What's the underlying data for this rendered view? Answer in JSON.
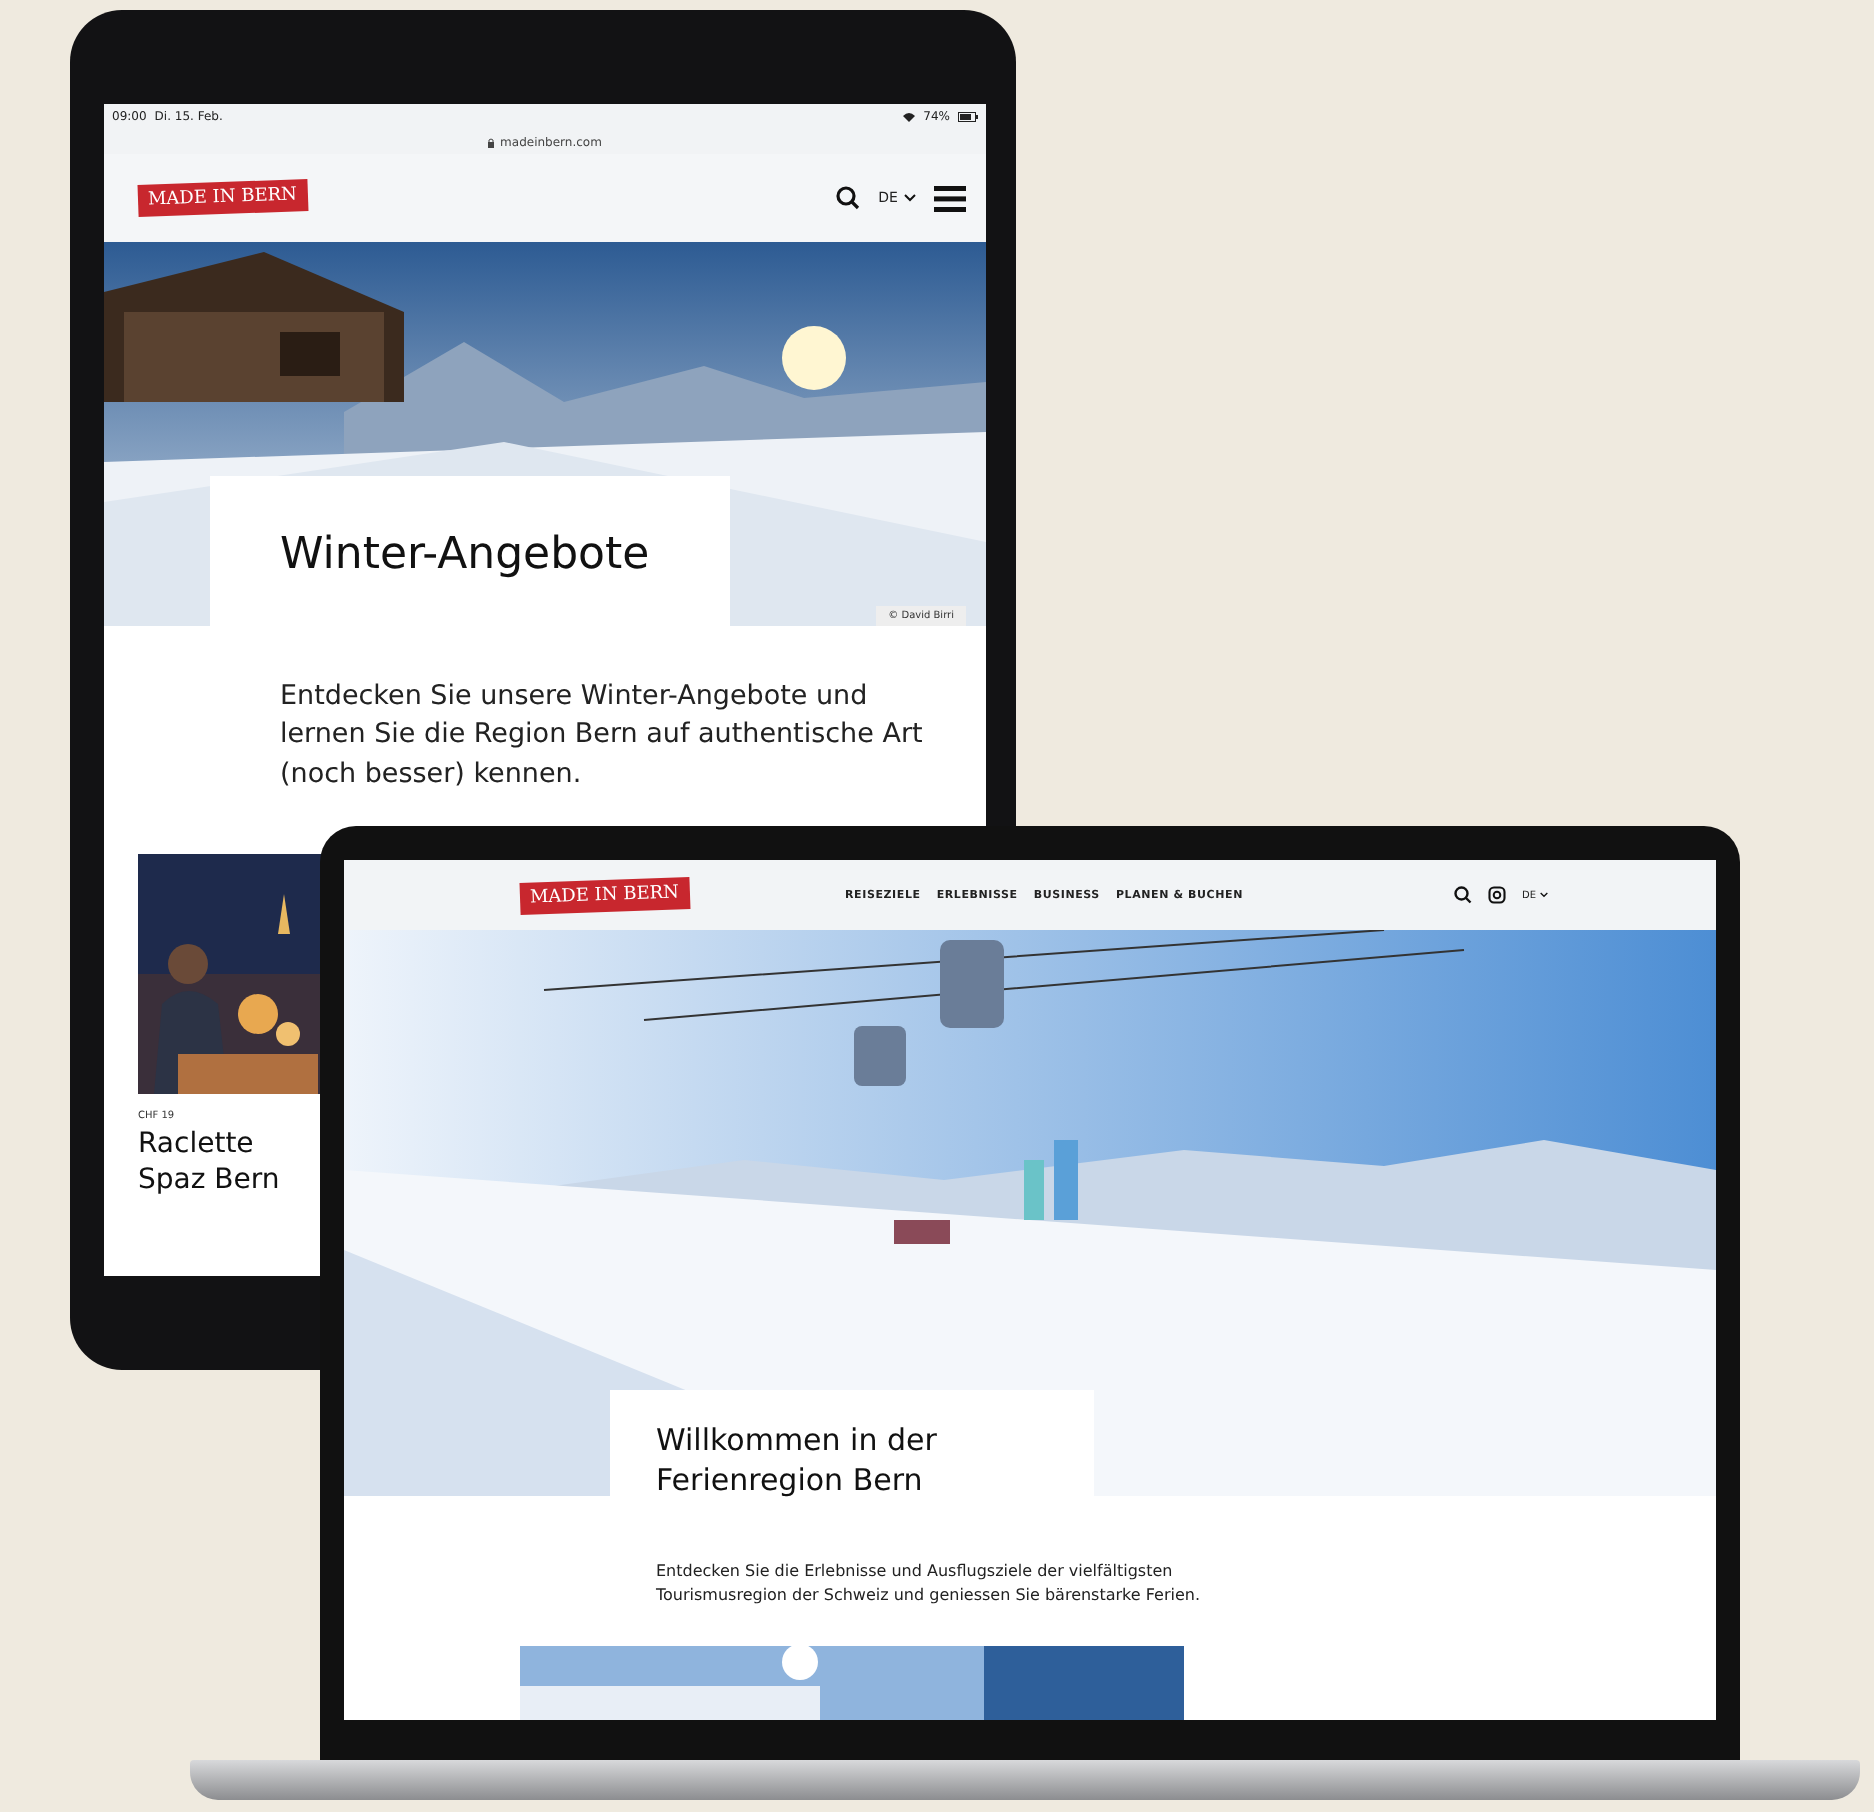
{
  "tablet": {
    "status_bar": {
      "time": "09:00",
      "date": "Di. 15. Feb.",
      "battery": "74%"
    },
    "address_bar": {
      "url": "madeinbern.com"
    },
    "header": {
      "logo": "MADE IN BERN",
      "language": "DE"
    },
    "hero": {
      "kind": "picture",
      "title": "Winter-Angebote",
      "credit": "© David Birri"
    },
    "intro": "Entdecken Sie unsere Winter-Angebote und lernen Sie die Region Bern auf authentische Art (noch besser) kennen.",
    "cards": [
      {
        "price": "CHF 19",
        "title": "Raclette Spaz Bern"
      }
    ]
  },
  "laptop": {
    "header": {
      "logo": "MADE IN BERN",
      "nav": [
        "REISEZIELE",
        "ERLEBNISSE",
        "BUSINESS",
        "PLANEN & BUCHEN"
      ],
      "language": "DE"
    },
    "hero": {
      "kind": "picture",
      "title": "Willkommen in der Ferienregion Bern"
    },
    "intro": "Entdecken Sie die Erlebnisse und Ausflugsziele der vielfältigsten Tourismusregion der Schweiz und geniessen Sie bärenstarke Ferien."
  }
}
